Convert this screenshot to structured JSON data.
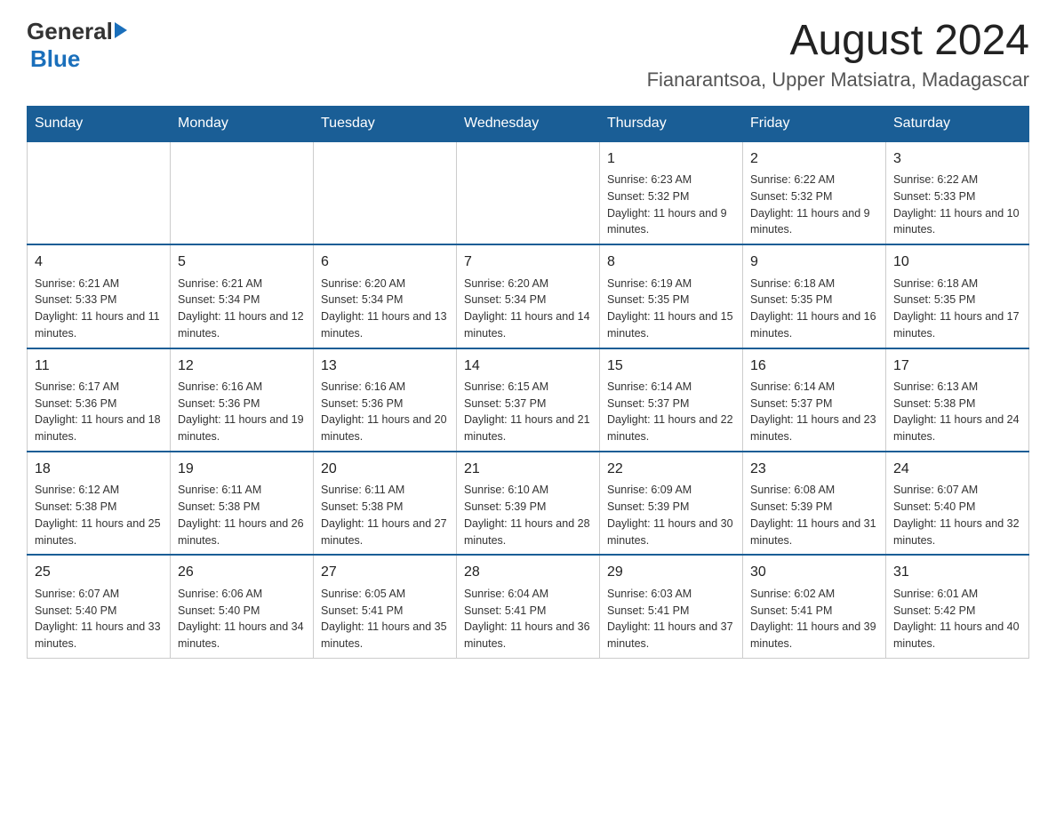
{
  "header": {
    "logo_general": "General",
    "logo_blue": "Blue",
    "month_title": "August 2024",
    "location": "Fianarantsoa, Upper Matsiatra, Madagascar"
  },
  "days_of_week": [
    "Sunday",
    "Monday",
    "Tuesday",
    "Wednesday",
    "Thursday",
    "Friday",
    "Saturday"
  ],
  "weeks": [
    {
      "days": [
        {
          "num": "",
          "info": ""
        },
        {
          "num": "",
          "info": ""
        },
        {
          "num": "",
          "info": ""
        },
        {
          "num": "",
          "info": ""
        },
        {
          "num": "1",
          "info": "Sunrise: 6:23 AM\nSunset: 5:32 PM\nDaylight: 11 hours and 9 minutes."
        },
        {
          "num": "2",
          "info": "Sunrise: 6:22 AM\nSunset: 5:32 PM\nDaylight: 11 hours and 9 minutes."
        },
        {
          "num": "3",
          "info": "Sunrise: 6:22 AM\nSunset: 5:33 PM\nDaylight: 11 hours and 10 minutes."
        }
      ]
    },
    {
      "days": [
        {
          "num": "4",
          "info": "Sunrise: 6:21 AM\nSunset: 5:33 PM\nDaylight: 11 hours and 11 minutes."
        },
        {
          "num": "5",
          "info": "Sunrise: 6:21 AM\nSunset: 5:34 PM\nDaylight: 11 hours and 12 minutes."
        },
        {
          "num": "6",
          "info": "Sunrise: 6:20 AM\nSunset: 5:34 PM\nDaylight: 11 hours and 13 minutes."
        },
        {
          "num": "7",
          "info": "Sunrise: 6:20 AM\nSunset: 5:34 PM\nDaylight: 11 hours and 14 minutes."
        },
        {
          "num": "8",
          "info": "Sunrise: 6:19 AM\nSunset: 5:35 PM\nDaylight: 11 hours and 15 minutes."
        },
        {
          "num": "9",
          "info": "Sunrise: 6:18 AM\nSunset: 5:35 PM\nDaylight: 11 hours and 16 minutes."
        },
        {
          "num": "10",
          "info": "Sunrise: 6:18 AM\nSunset: 5:35 PM\nDaylight: 11 hours and 17 minutes."
        }
      ]
    },
    {
      "days": [
        {
          "num": "11",
          "info": "Sunrise: 6:17 AM\nSunset: 5:36 PM\nDaylight: 11 hours and 18 minutes."
        },
        {
          "num": "12",
          "info": "Sunrise: 6:16 AM\nSunset: 5:36 PM\nDaylight: 11 hours and 19 minutes."
        },
        {
          "num": "13",
          "info": "Sunrise: 6:16 AM\nSunset: 5:36 PM\nDaylight: 11 hours and 20 minutes."
        },
        {
          "num": "14",
          "info": "Sunrise: 6:15 AM\nSunset: 5:37 PM\nDaylight: 11 hours and 21 minutes."
        },
        {
          "num": "15",
          "info": "Sunrise: 6:14 AM\nSunset: 5:37 PM\nDaylight: 11 hours and 22 minutes."
        },
        {
          "num": "16",
          "info": "Sunrise: 6:14 AM\nSunset: 5:37 PM\nDaylight: 11 hours and 23 minutes."
        },
        {
          "num": "17",
          "info": "Sunrise: 6:13 AM\nSunset: 5:38 PM\nDaylight: 11 hours and 24 minutes."
        }
      ]
    },
    {
      "days": [
        {
          "num": "18",
          "info": "Sunrise: 6:12 AM\nSunset: 5:38 PM\nDaylight: 11 hours and 25 minutes."
        },
        {
          "num": "19",
          "info": "Sunrise: 6:11 AM\nSunset: 5:38 PM\nDaylight: 11 hours and 26 minutes."
        },
        {
          "num": "20",
          "info": "Sunrise: 6:11 AM\nSunset: 5:38 PM\nDaylight: 11 hours and 27 minutes."
        },
        {
          "num": "21",
          "info": "Sunrise: 6:10 AM\nSunset: 5:39 PM\nDaylight: 11 hours and 28 minutes."
        },
        {
          "num": "22",
          "info": "Sunrise: 6:09 AM\nSunset: 5:39 PM\nDaylight: 11 hours and 30 minutes."
        },
        {
          "num": "23",
          "info": "Sunrise: 6:08 AM\nSunset: 5:39 PM\nDaylight: 11 hours and 31 minutes."
        },
        {
          "num": "24",
          "info": "Sunrise: 6:07 AM\nSunset: 5:40 PM\nDaylight: 11 hours and 32 minutes."
        }
      ]
    },
    {
      "days": [
        {
          "num": "25",
          "info": "Sunrise: 6:07 AM\nSunset: 5:40 PM\nDaylight: 11 hours and 33 minutes."
        },
        {
          "num": "26",
          "info": "Sunrise: 6:06 AM\nSunset: 5:40 PM\nDaylight: 11 hours and 34 minutes."
        },
        {
          "num": "27",
          "info": "Sunrise: 6:05 AM\nSunset: 5:41 PM\nDaylight: 11 hours and 35 minutes."
        },
        {
          "num": "28",
          "info": "Sunrise: 6:04 AM\nSunset: 5:41 PM\nDaylight: 11 hours and 36 minutes."
        },
        {
          "num": "29",
          "info": "Sunrise: 6:03 AM\nSunset: 5:41 PM\nDaylight: 11 hours and 37 minutes."
        },
        {
          "num": "30",
          "info": "Sunrise: 6:02 AM\nSunset: 5:41 PM\nDaylight: 11 hours and 39 minutes."
        },
        {
          "num": "31",
          "info": "Sunrise: 6:01 AM\nSunset: 5:42 PM\nDaylight: 11 hours and 40 minutes."
        }
      ]
    }
  ]
}
